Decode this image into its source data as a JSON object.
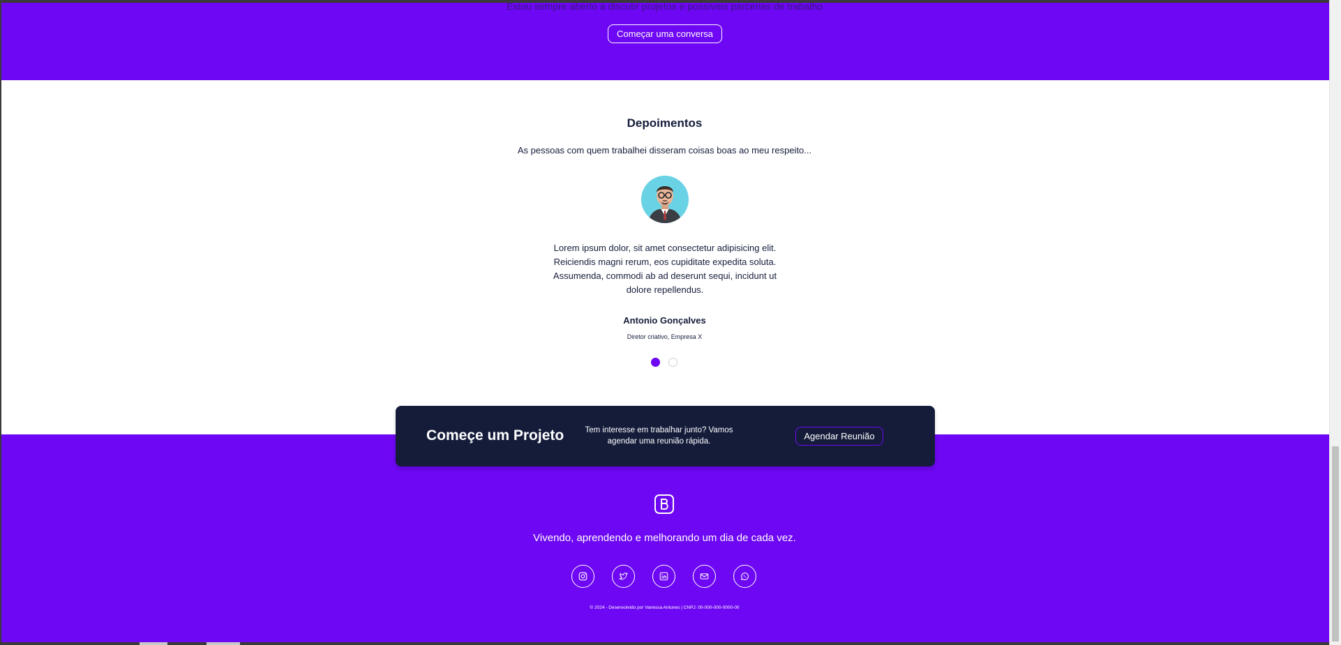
{
  "hero": {
    "text": "Estou sempre aberto a discutir projetos e possíveis parcerias de trabalho",
    "button_label": "Começar uma conversa"
  },
  "testimonials": {
    "title": "Depoimentos",
    "subtitle": "As pessoas com quem trabalhei disseram coisas boas ao meu respeito...",
    "quote": "Lorem ipsum dolor, sit amet consectetur adipisicing elit. Reiciendis magni rerum, eos cupiditate expedita soluta. Assumenda, commodi ab ad deserunt sequi, incidunt ut dolore repellendus.",
    "name": "Antonio Gonçalves",
    "role": "Diretor criativo, Empresa X",
    "slides": 2,
    "active_slide": 1
  },
  "cta": {
    "title": "Começe um Projeto",
    "text": "Tem interesse em trabalhar junto? Vamos agendar uma reunião rápida.",
    "button_label": "Agendar Reunião"
  },
  "footer": {
    "tagline": "Vivendo, aprendendo e melhorando um dia de cada vez.",
    "socials": [
      "instagram-icon",
      "twitter-icon",
      "linkedin-icon",
      "mail-icon",
      "whatsapp-icon"
    ],
    "copyright": "© 2024 - Desenvolvido por Vanessa Antunes | CNPJ: 00-000-000-0000-00"
  },
  "colors": {
    "brand_purple": "#6e07f3",
    "dark_navy": "#141c3a",
    "avatar_bg": "#69d3e5"
  }
}
